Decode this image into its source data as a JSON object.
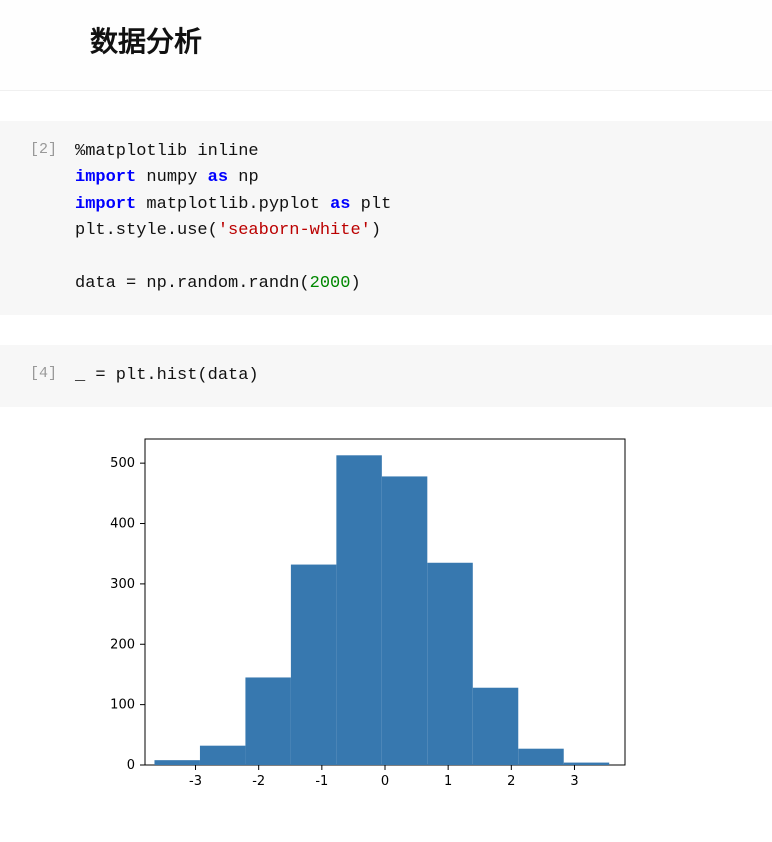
{
  "header": {
    "title": "数据分析"
  },
  "cells": [
    {
      "prompt": "[2]",
      "code_tokens": [
        {
          "t": "%matplotlib inline\n",
          "c": ""
        },
        {
          "t": "import",
          "c": "kw"
        },
        {
          "t": " numpy ",
          "c": ""
        },
        {
          "t": "as",
          "c": "kw"
        },
        {
          "t": " np\n",
          "c": ""
        },
        {
          "t": "import",
          "c": "kw"
        },
        {
          "t": " matplotlib.pyplot ",
          "c": ""
        },
        {
          "t": "as",
          "c": "kw"
        },
        {
          "t": " plt\n",
          "c": ""
        },
        {
          "t": "plt.style.use(",
          "c": ""
        },
        {
          "t": "'seaborn-white'",
          "c": "str-red"
        },
        {
          "t": ")\n\n",
          "c": ""
        },
        {
          "t": "data = np.random.randn(",
          "c": ""
        },
        {
          "t": "2000",
          "c": "num"
        },
        {
          "t": ")",
          "c": ""
        }
      ]
    },
    {
      "prompt": "[4]",
      "code_tokens": [
        {
          "t": "_ = plt.hist(data)",
          "c": ""
        }
      ]
    }
  ],
  "chart_data": {
    "type": "bar",
    "title": "",
    "xlabel": "",
    "ylabel": "",
    "x_ticks": [
      -3,
      -2,
      -1,
      0,
      1,
      2,
      3
    ],
    "y_ticks": [
      0,
      100,
      200,
      300,
      400,
      500
    ],
    "xlim": [
      -3.8,
      3.8
    ],
    "ylim": [
      0,
      540
    ],
    "bin_edges": [
      -3.65,
      -2.93,
      -2.21,
      -1.49,
      -0.77,
      -0.05,
      0.67,
      1.39,
      2.11,
      2.83,
      3.55
    ],
    "values": [
      8,
      32,
      145,
      332,
      513,
      478,
      335,
      128,
      27,
      4
    ]
  }
}
